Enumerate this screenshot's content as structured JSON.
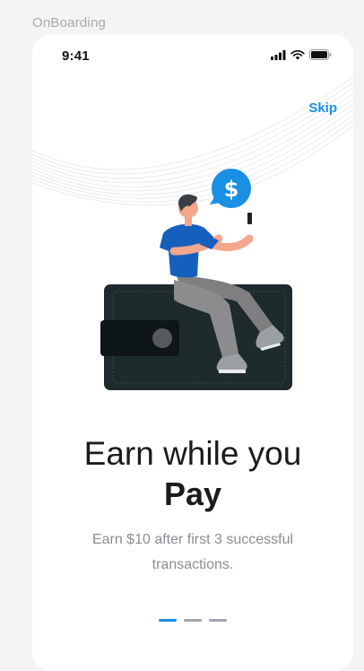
{
  "frame": {
    "label": "OnBoarding"
  },
  "status_bar": {
    "time": "9:41",
    "icons": [
      "cellular-signal-icon",
      "wifi-icon",
      "battery-icon"
    ]
  },
  "header": {
    "skip_label": "Skip"
  },
  "illustration": {
    "description_icon": "person-on-wallet-illustration",
    "badge_symbol": "$"
  },
  "content": {
    "title_line1": "Earn while you",
    "title_line2": "Pay",
    "subtitle": "Earn $10 after first 3 successful transactions."
  },
  "pagination": {
    "pages": 3,
    "active_index": 0
  },
  "colors": {
    "accent": "#1a8fe3",
    "wallet": "#1e2b2d",
    "shirt": "#1560bd",
    "pants": "#7f7f82",
    "dot_inactive": "#a3a6b0"
  }
}
